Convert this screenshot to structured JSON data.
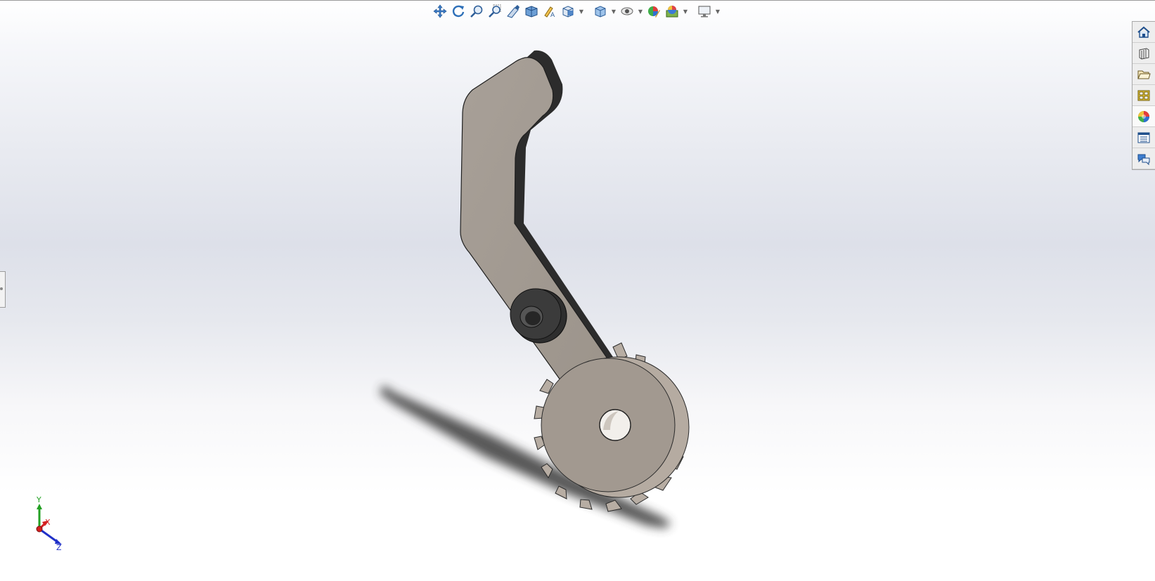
{
  "toolbar": {
    "buttons": [
      {
        "name": "pan-icon",
        "color": "#2a6fb0"
      },
      {
        "name": "rotate-icon",
        "color": "#2a6fb0"
      },
      {
        "name": "zoom-to-fit-icon",
        "color": "#2a6fb0"
      },
      {
        "name": "zoom-to-area-icon",
        "color": "#2a6fb0"
      },
      {
        "name": "previous-view-icon",
        "color": "#2a6fb0"
      },
      {
        "name": "section-view-icon",
        "color": "#2a6fb0"
      },
      {
        "name": "dynamic-annotation-views-icon",
        "color": "#2a6fb0"
      },
      {
        "name": "view-orientation-icon",
        "color": "#2a6fb0"
      },
      {
        "name": "display-style-icon",
        "color": "#2a6fb0"
      },
      {
        "name": "hide-show-items-icon",
        "color": "#2a6fb0"
      },
      {
        "name": "edit-appearance-icon",
        "color": "#2a6fb0"
      },
      {
        "name": "apply-scene-icon",
        "color": "#2a6fb0"
      },
      {
        "name": "view-settings-icon",
        "color": "#2a6fb0"
      }
    ]
  },
  "task_pane": {
    "items": [
      {
        "name": "home-icon"
      },
      {
        "name": "design-library-icon"
      },
      {
        "name": "file-explorer-icon"
      },
      {
        "name": "view-palette-icon"
      },
      {
        "name": "appearances-icon"
      },
      {
        "name": "custom-properties-icon"
      },
      {
        "name": "forum-icon"
      }
    ]
  },
  "triad": {
    "x_label": "X",
    "y_label": "Y",
    "z_label": "Z"
  },
  "colors": {
    "part_face": "#a39a91",
    "part_side": "#2f2f2f",
    "axis_x": "#d42020",
    "axis_y": "#23a023",
    "axis_z": "#2030c8"
  }
}
